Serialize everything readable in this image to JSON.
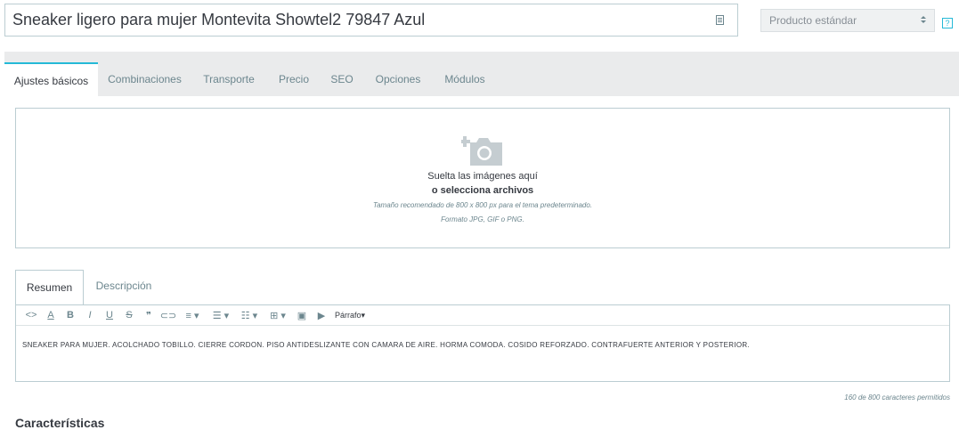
{
  "product": {
    "name": "Sneaker ligero para mujer  Montevita Showtel2 79847 Azul",
    "type": "Producto estándar",
    "help": "?"
  },
  "tabs": [
    {
      "label": "Ajustes básicos",
      "active": true
    },
    {
      "label": "Combinaciones"
    },
    {
      "label": "Transporte"
    },
    {
      "label": "Precio"
    },
    {
      "label": "SEO"
    },
    {
      "label": "Opciones"
    },
    {
      "label": "Módulos"
    }
  ],
  "dropzone": {
    "line1": "Suelta las imágenes aquí",
    "line2": "o selecciona archivos",
    "line3": "Tamaño recomendado de 800 x 800 px para el tema predeterminado.",
    "line4": "Formato JPG, GIF o PNG."
  },
  "description_tabs": [
    {
      "label": "Resumen",
      "active": true
    },
    {
      "label": "Descripción"
    }
  ],
  "editor": {
    "format_label": "Párrafo",
    "content": "SNEAKER PARA MUJER. ACOLCHADO TOBILLO. CIERRE CORDON. PISO ANTIDESLIZANTE CON CAMARA DE AIRE. HORMA COMODA. COSIDO REFORZADO. CONTRAFUERTE ANTERIOR Y POSTERIOR.",
    "char_count": "160 de 800 caracteres permitidos"
  },
  "section": {
    "title": "Características"
  },
  "colors": {
    "accent": "#25b9d7",
    "border": "#bbcdd2",
    "tabs_bg": "#eaebec"
  }
}
